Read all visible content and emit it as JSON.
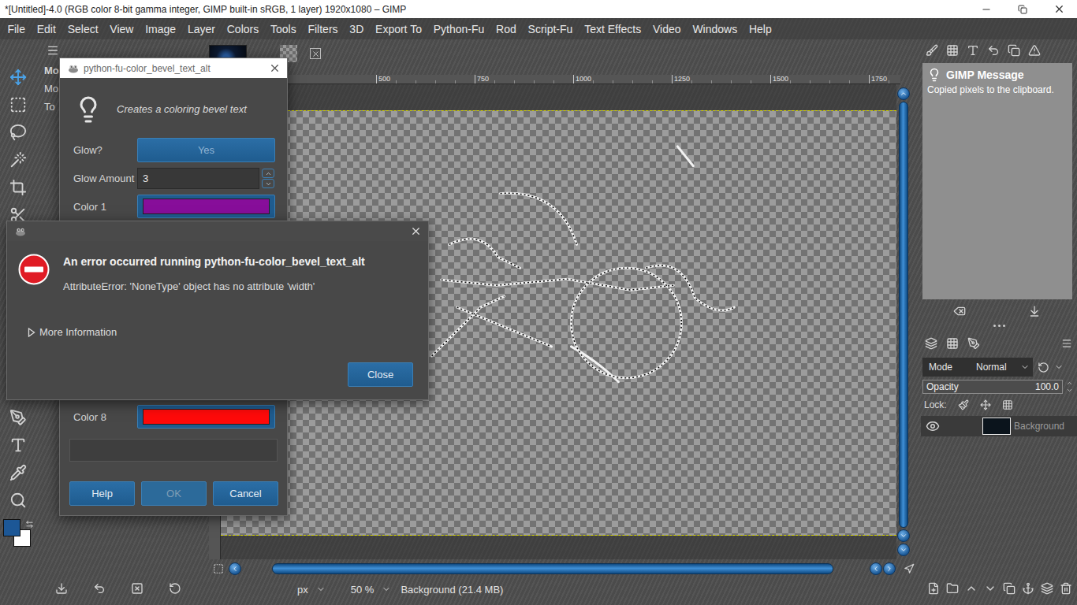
{
  "window": {
    "title": "*[Untitled]-4.0 (RGB color 8-bit gamma integer, GIMP built-in sRGB, 1 layer) 1920x1080 – GIMP"
  },
  "menu": [
    "File",
    "Edit",
    "Select",
    "View",
    "Image",
    "Layer",
    "Colors",
    "Tools",
    "Filters",
    "3D",
    "Export To",
    "Python-Fu",
    "Rod",
    "Script-Fu",
    "Text Effects",
    "Video",
    "Windows",
    "Help"
  ],
  "toolbox": {
    "tools": [
      {
        "selected": true
      },
      {
        "selected": false
      },
      {
        "selected": false
      },
      {
        "selected": false
      },
      {
        "selected": false
      },
      {
        "selected": false
      },
      {
        "selected": false
      },
      {
        "selected": false
      },
      {
        "selected": false
      },
      {
        "selected": false
      }
    ],
    "foreground": "#1c5796",
    "background": "#ffffff"
  },
  "tool_options": {
    "labels": [
      "Mo",
      "Mo",
      "To"
    ]
  },
  "canvas": {
    "ruler_ticks": [
      "500",
      "750",
      "1000",
      "1250",
      "1500",
      "1750"
    ]
  },
  "message_panel": {
    "title": "GIMP Message",
    "text": "Copied pixels to the clipboard."
  },
  "layers_panel": {
    "mode_label": "Mode",
    "mode": "Normal",
    "opacity_label": "Opacity",
    "opacity": "100.0",
    "opacity_level": 1.0,
    "lock_label": "Lock:",
    "layers": [
      {
        "name": "Background",
        "visible": true,
        "selected": true
      }
    ]
  },
  "status_bar": {
    "unit": "px",
    "zoom": "50 %",
    "info": "Background (21.4 MB)"
  },
  "plugin_dialog": {
    "title": "python-fu-color_bevel_text_alt",
    "description": "Creates a coloring bevel text",
    "fields": [
      {
        "kind": "toggle",
        "label": "Glow?",
        "value": "Yes",
        "on": true
      },
      {
        "kind": "spin",
        "label": "Glow Amount",
        "value": "3"
      },
      {
        "kind": "color",
        "label": "Color 1",
        "color": "#870e9a"
      },
      {
        "kind": "color",
        "label": "Color 8",
        "color": "#ff0a0a"
      }
    ],
    "progress": {
      "level": 0
    },
    "buttons": [
      {
        "label": "Help",
        "disabled": false
      },
      {
        "label": "OK",
        "disabled": true
      },
      {
        "label": "Cancel",
        "disabled": false
      }
    ]
  },
  "error_dialog": {
    "heading": "An error occurred running python-fu-color_bevel_text_alt",
    "message": "AttributeError: 'NoneType' object has no attribute 'width'",
    "details": {
      "label": "More Information",
      "expanded": false
    },
    "buttons": [
      "Close"
    ]
  }
}
